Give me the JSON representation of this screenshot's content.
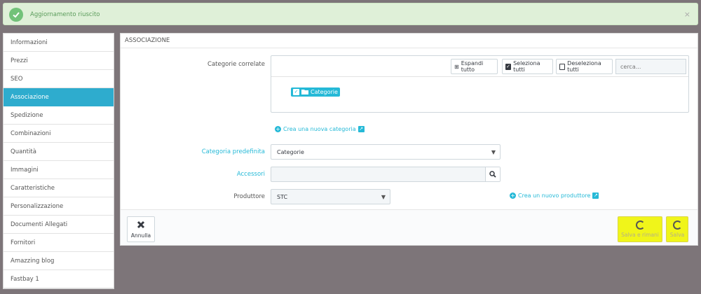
{
  "alert": {
    "message": "Aggiornamento riuscito",
    "close": "×"
  },
  "sidebar": {
    "items": [
      {
        "label": "Informazioni"
      },
      {
        "label": "Prezzi"
      },
      {
        "label": "SEO"
      },
      {
        "label": "Associazione",
        "active": true
      },
      {
        "label": "Spedizione"
      },
      {
        "label": "Combinazioni"
      },
      {
        "label": "Quantità"
      },
      {
        "label": "Immagini"
      },
      {
        "label": "Caratteristiche"
      },
      {
        "label": "Personalizzazione"
      },
      {
        "label": "Documenti Allegati"
      },
      {
        "label": "Fornitori"
      },
      {
        "label": "Amazzing blog"
      },
      {
        "label": "Fastbay 1"
      }
    ]
  },
  "panel": {
    "title": "ASSOCIAZIONE",
    "categorie_correlate_label": "Categorie correlate",
    "tree": {
      "expand_all": "Espandi tutto",
      "select_all": "Seleziona tutti",
      "deselect_all": "Deseleziona tutti",
      "search_placeholder": "cerca...",
      "root_node": "Categorie"
    },
    "new_category_link": "Crea una nuova categoria",
    "default_category_label": "Categoria predefinita",
    "default_category_value": "Categorie",
    "accessories_label": "Accessori",
    "accessories_value": "",
    "manufacturer_label": "Produttore",
    "manufacturer_value": "STC",
    "new_manufacturer_link": "Crea un nuovo produttore",
    "footer": {
      "cancel_label": "Annulla",
      "save_stay_label": "Salva e rimani",
      "save_label": "Salva"
    }
  },
  "colors": {
    "accent": "#25b9d7",
    "active_tab": "#2eacce",
    "success_bg": "#dff0d8",
    "highlight": "#f0f51a",
    "background": "#7d7579"
  }
}
